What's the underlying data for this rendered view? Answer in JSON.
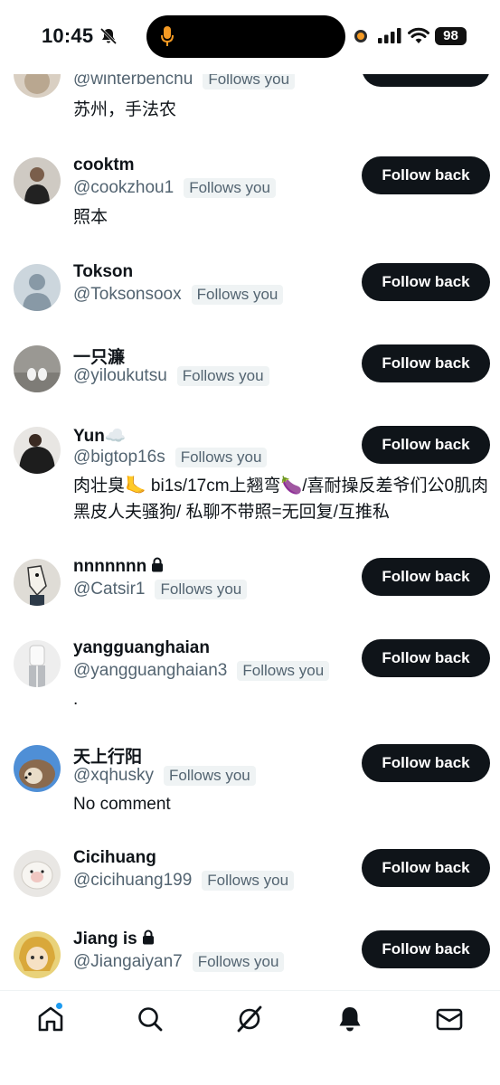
{
  "status_bar": {
    "time": "10:45",
    "battery": "98"
  },
  "users": [
    {
      "name": "",
      "handle": "@winterbenchu",
      "follows": "Follows you",
      "bio": "苏州，手法农",
      "button": "Follow back"
    },
    {
      "name": "cooktm",
      "handle": "@cookzhou1",
      "follows": "Follows you",
      "bio": "照本",
      "button": "Follow back"
    },
    {
      "name": "Tokson",
      "handle": "@Toksonsoox",
      "follows": "Follows you",
      "bio": "",
      "button": "Follow back"
    },
    {
      "name": "一只濂",
      "handle": "@yiloukutsu",
      "follows": "Follows you",
      "bio": "",
      "button": "Follow back"
    },
    {
      "name": "Yun☁️",
      "handle": "@bigtop16s",
      "follows": "Follows you",
      "bio": "肉壮臭🦶 bi1s/17cm上翘弯🍆/喜耐操反差爷们公0肌肉黑皮人夫骚狗/ 私聊不带照=无回复/互推私",
      "button": "Follow back"
    },
    {
      "name": "nnnnnnn",
      "handle": "@Catsir1",
      "follows": "Follows you",
      "bio": "",
      "button": "Follow back"
    },
    {
      "name": "yangguanghaian",
      "handle": "@yangguanghaian3",
      "follows": "Follows you",
      "bio": ".",
      "button": "Follow back"
    },
    {
      "name": "天上行阳",
      "handle": "@xqhusky",
      "follows": "Follows you",
      "bio": "No comment",
      "button": "Follow back"
    },
    {
      "name": "Cicihuang",
      "handle": "@cicihuang199",
      "follows": "Follows you",
      "bio": "",
      "button": "Follow back"
    },
    {
      "name": "Jiang is",
      "handle": "@Jiangaiyan7",
      "follows": "Follows you",
      "bio": "",
      "button": "Follow back"
    }
  ],
  "nav": {
    "icons": [
      "home-icon",
      "search-icon",
      "grok-icon",
      "notifications-icon",
      "messages-icon"
    ],
    "accent": "#1d9bf0"
  }
}
